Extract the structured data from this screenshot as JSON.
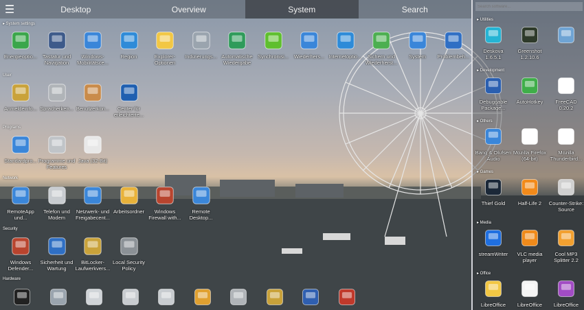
{
  "tabs": [
    {
      "label": "Desktop"
    },
    {
      "label": "Overview"
    },
    {
      "label": "System"
    },
    {
      "label": "Search"
    }
  ],
  "menu_icon": "hamburger-icon",
  "sections": {
    "system_settings": {
      "title": "▸ System settings",
      "items": [
        {
          "label": "Energieoptio...",
          "icon": "battery-icon"
        },
        {
          "label": "Tastatur und Navigation",
          "icon": "keyboard-icon"
        },
        {
          "label": "Windows-Mobilitätsce...",
          "icon": "laptop-icon"
        },
        {
          "label": "Region",
          "icon": "globe-clock-icon"
        },
        {
          "label": "Explorer-Optionen",
          "icon": "folder-options-icon"
        },
        {
          "label": "Indizierungs...",
          "icon": "indexing-icon"
        },
        {
          "label": "Automatische Wiedergabe",
          "icon": "autoplay-icon"
        },
        {
          "label": "Synchronisi...",
          "icon": "sync-icon"
        },
        {
          "label": "Wiederhers...",
          "icon": "restore-icon"
        },
        {
          "label": "Internetoptio...",
          "icon": "internet-options-icon"
        },
        {
          "label": "Sichern und Wiederherst...",
          "icon": "backup-icon"
        },
        {
          "label": "System",
          "icon": "system-icon"
        },
        {
          "label": "Problembeh...",
          "icon": "troubleshoot-icon"
        }
      ]
    },
    "user": {
      "title": "User",
      "items": [
        {
          "label": "Anmeldeinfo...",
          "icon": "credential-icon"
        },
        {
          "label": "Spracherken...",
          "icon": "microphone-icon"
        },
        {
          "label": "Benutzerkon...",
          "icon": "users-icon"
        },
        {
          "label": "Center für erleichterte...",
          "icon": "ease-of-access-icon"
        }
      ]
    },
    "programs": {
      "title": "Programs",
      "items": [
        {
          "label": "Standardpro...",
          "icon": "default-programs-icon"
        },
        {
          "label": "Programme und Features",
          "icon": "programs-features-icon"
        },
        {
          "label": "Java (32-Bit)",
          "icon": "java-icon"
        }
      ]
    },
    "network": {
      "title": "Network",
      "items": [
        {
          "label": "RemoteApp und...",
          "icon": "remoteapp-icon"
        },
        {
          "label": "Telefon und Modem",
          "icon": "phone-modem-icon"
        },
        {
          "label": "Netzwerk- und Freigabecent...",
          "icon": "network-center-icon"
        },
        {
          "label": "Arbeitsordner",
          "icon": "work-folders-icon"
        },
        {
          "label": "Windows Firewall with...",
          "icon": "firewall-icon"
        },
        {
          "label": "Remote Desktop...",
          "icon": "remote-desktop-icon"
        }
      ]
    },
    "security": {
      "title": "Security",
      "items": [
        {
          "label": "Windows Defender...",
          "icon": "defender-icon"
        },
        {
          "label": "Sicherheit und Wartung",
          "icon": "flag-icon"
        },
        {
          "label": "BitLocker-Laufwerkvers...",
          "icon": "bitlocker-icon"
        },
        {
          "label": "Local Security Policy",
          "icon": "security-policy-icon"
        }
      ]
    },
    "hardware": {
      "title": "Hardware",
      "items": [
        {
          "icon": "bang-olufsen-icon"
        },
        {
          "icon": "mouse-icon"
        },
        {
          "icon": "keyboard-flat-icon"
        },
        {
          "icon": "devices-icon"
        },
        {
          "icon": "printer-icon"
        },
        {
          "icon": "color-management-icon"
        },
        {
          "icon": "sound-icon"
        },
        {
          "icon": "scanner-icon"
        },
        {
          "icon": "xbox-icon"
        },
        {
          "icon": "device-manager-icon"
        }
      ]
    }
  },
  "sidebar": {
    "search_placeholder": "Search software...",
    "utilities": {
      "title": "▸ Utilities",
      "items": [
        {
          "label": "Deskova 1.6.5.1",
          "icon": "deskova-icon"
        },
        {
          "label": "Greenshot 1.2.10.6",
          "icon": "greenshot-icon"
        },
        {
          "label": "",
          "icon": "blurred-app-icon"
        }
      ]
    },
    "development": {
      "title": "▸ Development",
      "items": [
        {
          "label": "Debuggable Package...",
          "icon": "powershell-icon"
        },
        {
          "label": "AutoHotkey",
          "icon": "autohotkey-icon"
        },
        {
          "label": "FreeCAD 0.20.2",
          "icon": "window-icon"
        }
      ]
    },
    "others": {
      "title": "▸ Others",
      "items": [
        {
          "label": "Bang & Olufsen Audio",
          "icon": "bo-audio-icon"
        },
        {
          "label": "Mozilla Firefox (64-bit)",
          "icon": "window-icon"
        },
        {
          "label": "Mozilla Thunderbird...",
          "icon": "window-icon"
        }
      ]
    },
    "games": {
      "title": "▸ Games",
      "items": [
        {
          "label": "Thief Gold",
          "icon": "steam-icon"
        },
        {
          "label": "Half-Life 2",
          "icon": "half-life-icon"
        },
        {
          "label": "Counter-Strike: Source",
          "icon": "counter-strike-icon"
        }
      ]
    },
    "media": {
      "title": "▸ Media",
      "items": [
        {
          "label": "streamWriter",
          "icon": "music-note-icon"
        },
        {
          "label": "VLC media player",
          "icon": "vlc-icon"
        },
        {
          "label": "Cool MP3 Splitter 2.2",
          "icon": "smiley-icon"
        }
      ]
    },
    "office": {
      "title": "▸ Office",
      "items": [
        {
          "label": "LibreOffice",
          "icon": "folder-icon"
        },
        {
          "label": "LibreOffice",
          "icon": "document-icon"
        },
        {
          "label": "LibreOffice",
          "icon": "libreoffice-math-icon"
        }
      ]
    }
  },
  "colors": {
    "accent": "#3a86d9",
    "topbar": "#5a6068",
    "active_tab": "#3c4046"
  }
}
